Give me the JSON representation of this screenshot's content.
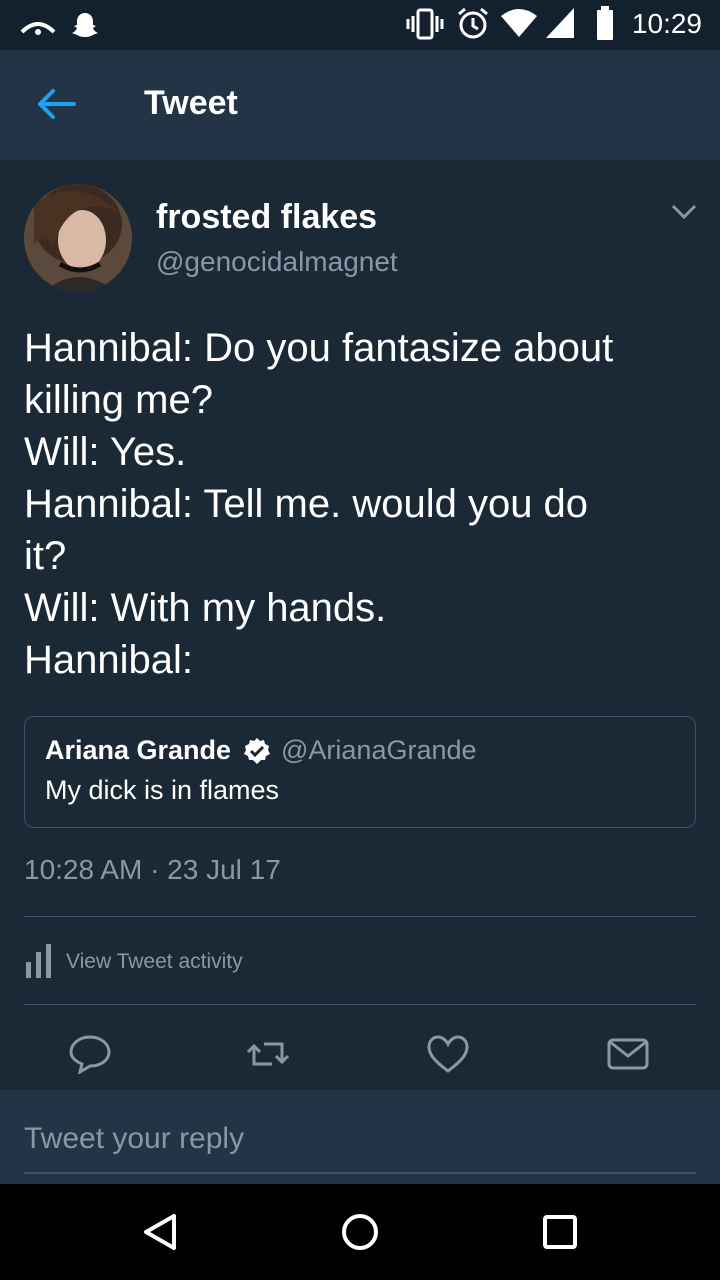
{
  "status_bar": {
    "time": "10:29",
    "icons": [
      "cast-icon",
      "snapchat-icon",
      "vibrate-icon",
      "alarm-icon",
      "wifi-icon",
      "signal-icon",
      "battery-icon"
    ]
  },
  "header": {
    "title": "Tweet",
    "back_icon": "back-arrow-icon"
  },
  "tweet": {
    "author_name": "frosted flakes",
    "author_handle": "@genocidalmagnet",
    "text_lines": [
      "Hannibal: Do you fantasize about",
      "killing me?",
      "Will: Yes.",
      "Hannibal: Tell me. would you do",
      "it?",
      "Will: With my hands.",
      "Hannibal:"
    ],
    "quoted": {
      "name": "Ariana Grande",
      "handle": "@ArianaGrande",
      "text": "My dick is in flames",
      "verified": true
    },
    "timestamp": "10:28 AM · 23 Jul 17",
    "activity_label": "View Tweet activity"
  },
  "actions": [
    "reply-icon",
    "retweet-icon",
    "like-icon",
    "direct-message-icon"
  ],
  "reply": {
    "placeholder": "Tweet your reply"
  },
  "colors": {
    "background": "#1b2836",
    "header": "#243447",
    "accent": "#1da1f2",
    "muted": "#8899a6"
  }
}
